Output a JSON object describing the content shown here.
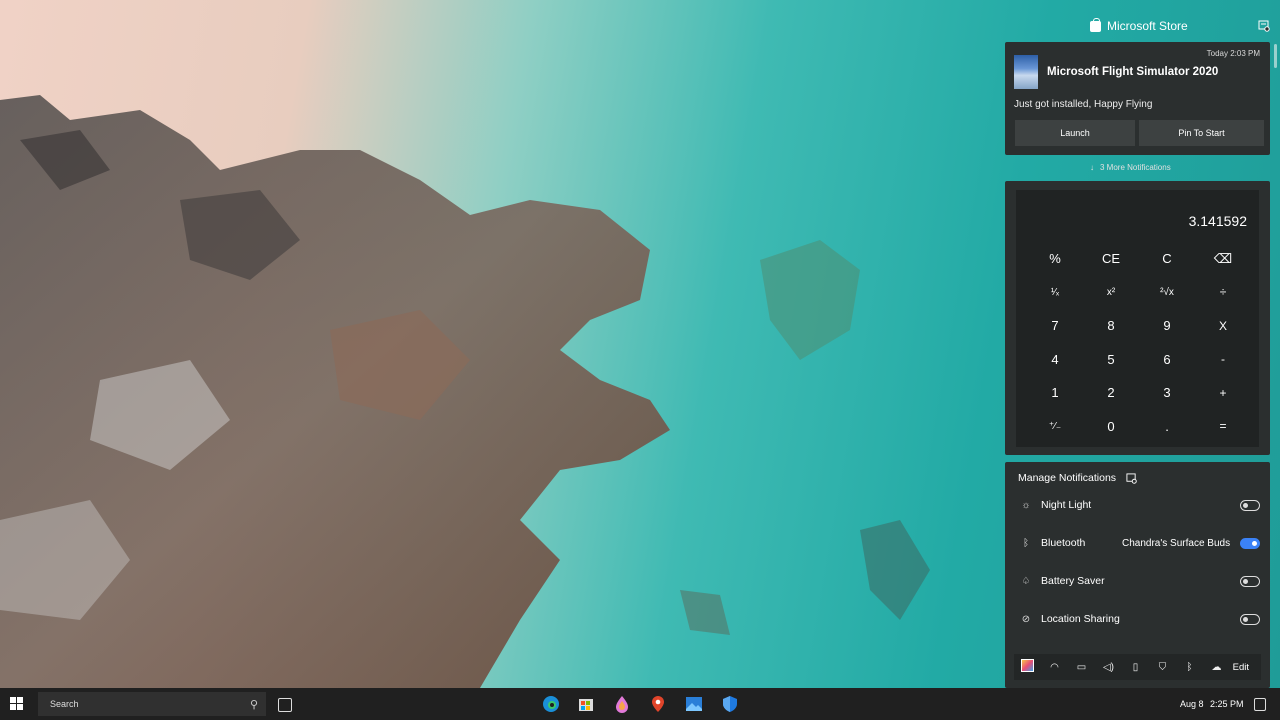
{
  "notification_center": {
    "app_name": "Microsoft Store",
    "notification": {
      "time": "Today 2:03 PM",
      "title": "Microsoft Flight Simulator 2020",
      "body": "Just got installed, Happy Flying",
      "actions": [
        "Launch",
        "Pin To Start"
      ]
    },
    "more_notifications": "3 More Notifications"
  },
  "calculator": {
    "display": "3.141592",
    "keys": [
      "%",
      "CE",
      "C",
      "⌫",
      "¹⁄ₓ",
      "x²",
      "²√x",
      "÷",
      "7",
      "8",
      "9",
      "X",
      "4",
      "5",
      "6",
      "-",
      "1",
      "2",
      "3",
      "+",
      "⁺⁄₋",
      "0",
      ".",
      "="
    ]
  },
  "quick_settings": {
    "header": "Manage Notifications",
    "items": [
      {
        "label": "Night Light",
        "icon": "sun-icon",
        "value": "",
        "on": false
      },
      {
        "label": "Bluetooth",
        "icon": "bluetooth-icon",
        "value": "Chandra's Surface Buds",
        "on": true
      },
      {
        "label": "Battery Saver",
        "icon": "battery-saver-icon",
        "value": "",
        "on": false
      },
      {
        "label": "Location Sharing",
        "icon": "location-icon",
        "value": "",
        "on": false
      }
    ],
    "bar_icons": [
      "color-settings-icon",
      "wifi-icon",
      "battery-icon",
      "volume-icon",
      "power-icon",
      "shield-icon",
      "bluetooth-icon",
      "cloud-icon"
    ],
    "edit_label": "Edit"
  },
  "taskbar": {
    "search_placeholder": "Search",
    "apps": [
      "edge-icon",
      "store-icon",
      "paint-icon",
      "maps-icon",
      "photos-icon",
      "defender-icon"
    ],
    "date": "Aug 8",
    "time": "2:25 PM"
  },
  "colors": {
    "panel": "#2b2f2f",
    "taskbar": "#202020",
    "accent": "#3b82f6"
  }
}
